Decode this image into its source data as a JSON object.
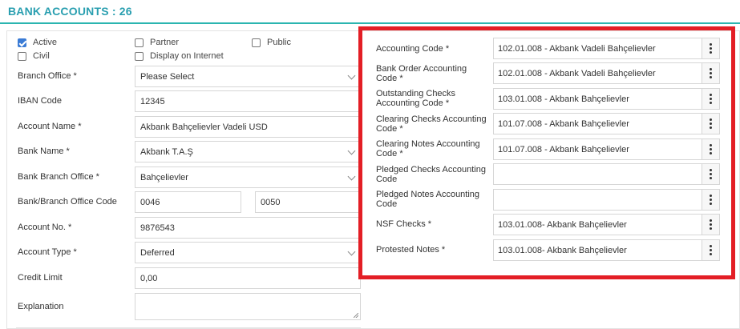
{
  "header": {
    "title": "BANK ACCOUNTS : 26"
  },
  "checkboxes": {
    "active": {
      "label": "Active",
      "checked": true
    },
    "civil": {
      "label": "Civil",
      "checked": false
    },
    "partner": {
      "label": "Partner",
      "checked": false
    },
    "display": {
      "label": "Display on Internet",
      "checked": false
    },
    "public": {
      "label": "Public",
      "checked": false
    }
  },
  "left_form": {
    "branch_office": {
      "label": "Branch Office *",
      "value": "Please Select"
    },
    "iban": {
      "label": "IBAN Code",
      "value": "12345"
    },
    "account_name": {
      "label": "Account Name *",
      "value": "Akbank Bahçelievler Vadeli USD"
    },
    "bank_name": {
      "label": "Bank Name *",
      "value": "Akbank T.A.Ş"
    },
    "bank_branch": {
      "label": "Bank Branch Office *",
      "value": "Bahçelievler"
    },
    "branch_code": {
      "label": "Bank/Branch Office Code",
      "value1": "0046",
      "value2": "0050"
    },
    "account_no": {
      "label": "Account No. *",
      "value": "9876543"
    },
    "account_type": {
      "label": "Account Type *",
      "value": "Deferred"
    },
    "credit_limit": {
      "label": "Credit Limit",
      "value": "0,00"
    },
    "explanation": {
      "label": "Explanation",
      "value": ""
    }
  },
  "accounting": [
    {
      "label": "Accounting Code *",
      "value": "102.01.008 - Akbank Vadeli Bahçelievler"
    },
    {
      "label": "Bank Order Accounting Code *",
      "value": "102.01.008 - Akbank Vadeli Bahçelievler"
    },
    {
      "label": "Outstanding Checks Accounting Code *",
      "value": "103.01.008 - Akbank Bahçelievler"
    },
    {
      "label": "Clearing Checks Accounting Code *",
      "value": "101.07.008 - Akbank Bahçelievler"
    },
    {
      "label": "Clearing Notes Accounting Code *",
      "value": "101.07.008 - Akbank Bahçelievler"
    },
    {
      "label": "Pledged Checks Accounting Code",
      "value": ""
    },
    {
      "label": "Pledged Notes Accounting Code",
      "value": ""
    },
    {
      "label": "NSF Checks *",
      "value": "103.01.008- Akbank Bahçelievler"
    },
    {
      "label": "Protested Notes *",
      "value": "103.01.008- Akbank Bahçelievler"
    }
  ]
}
